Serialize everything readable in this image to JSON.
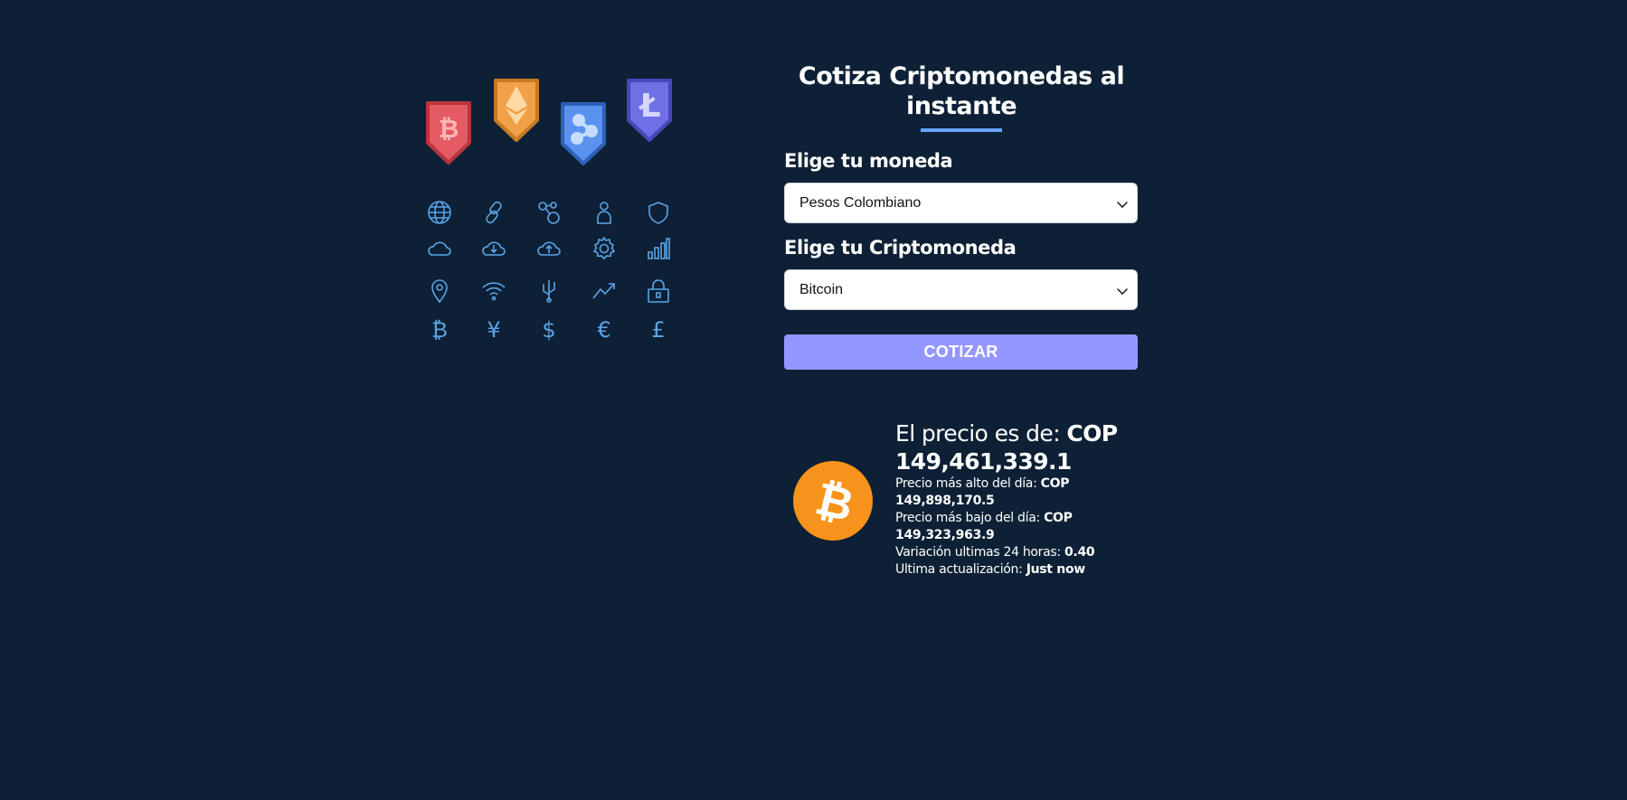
{
  "colors": {
    "background": "#0d2035",
    "accent": "#66a2fe",
    "button": "#9497ff",
    "icon_line": "#5aa5e6",
    "bitcoin_orange": "#f7931a"
  },
  "illustration": {
    "badges": [
      {
        "name": "bitcoin-badge",
        "symbol": "bitcoin",
        "color": "#e45b63"
      },
      {
        "name": "ethereum-badge",
        "symbol": "ethereum",
        "color": "#f0a046"
      },
      {
        "name": "ripple-badge",
        "symbol": "ripple",
        "color": "#5a92f0"
      },
      {
        "name": "litecoin-badge",
        "symbol": "litecoin",
        "color": "#6f6fe6"
      }
    ],
    "icons": [
      "globe-icon",
      "link-icon",
      "network-icon",
      "user-icon",
      "shield-icon",
      "cloud-icon",
      "cloud-download-icon",
      "cloud-upload-icon",
      "gear-icon",
      "bar-chart-icon",
      "location-pin-icon",
      "wifi-icon",
      "usb-icon",
      "trend-up-icon",
      "lock-icon",
      "bitcoin-symbol-icon",
      "yen-icon",
      "dollar-icon",
      "euro-icon",
      "pound-icon"
    ],
    "glyphs": {
      "bitcoin": "₿",
      "yen": "¥",
      "dollar": "$",
      "euro": "€",
      "pound": "£"
    }
  },
  "form": {
    "title": "Cotiza Criptomonedas al instante",
    "currency_label": "Elige tu moneda",
    "currency_selected": "Pesos Colombiano",
    "crypto_label": "Elige tu Criptomoneda",
    "crypto_selected": "Bitcoin",
    "submit_label": "COTIZAR"
  },
  "result": {
    "price_label": "El precio es de: ",
    "price_value": "COP 149,461,339.1",
    "high_label": "Precio más alto del día: ",
    "high_value": "COP 149,898,170.5",
    "low_label": "Precio más bajo del día: ",
    "low_value": "COP 149,323,963.9",
    "change_label": "Variación ultimas 24 horas: ",
    "change_value": "0.40",
    "updated_label": "Ultima actualización: ",
    "updated_value": "Just now"
  }
}
